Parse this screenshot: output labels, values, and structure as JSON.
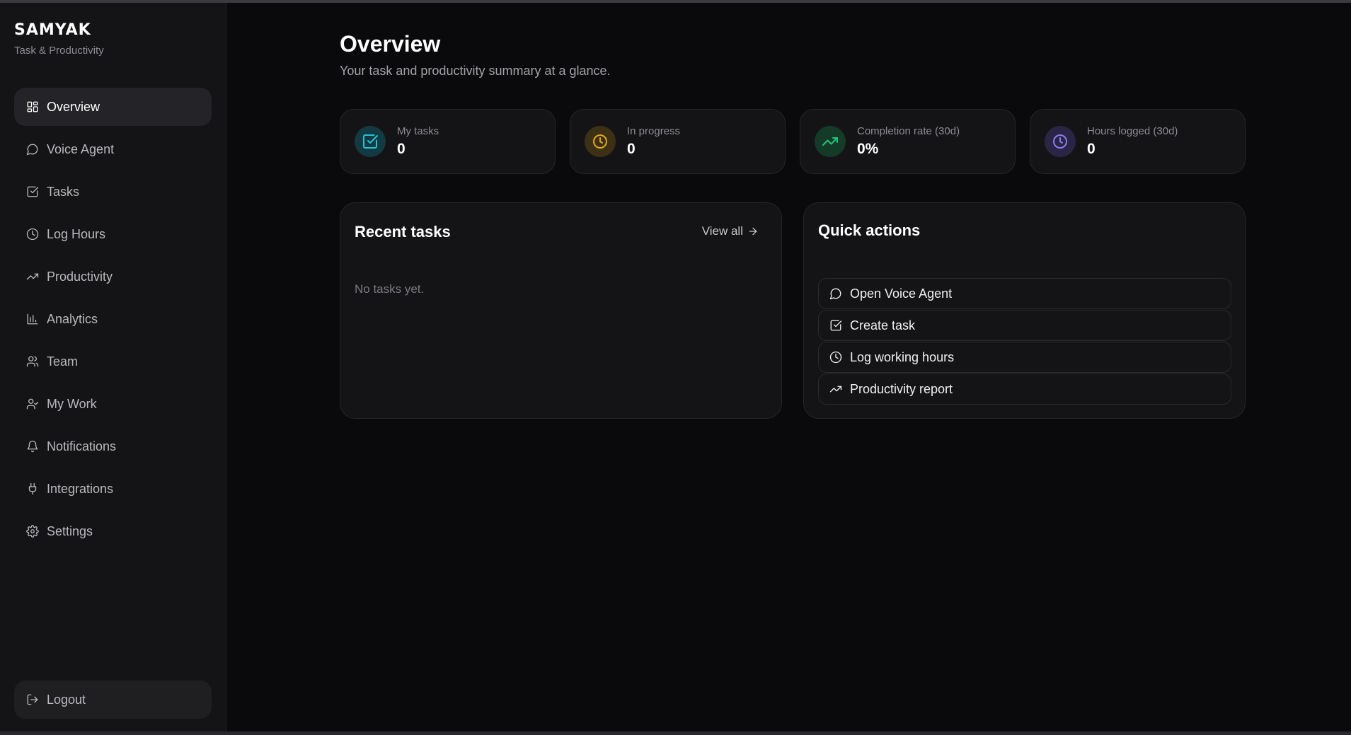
{
  "brand": {
    "name": "SAMYAK",
    "subtitle": "Task & Productivity"
  },
  "sidebar": {
    "items": [
      {
        "label": "Overview",
        "icon": "grid-icon",
        "active": true
      },
      {
        "label": "Voice Agent",
        "icon": "chat-bubble-icon"
      },
      {
        "label": "Tasks",
        "icon": "checkbox-icon"
      },
      {
        "label": "Log Hours",
        "icon": "clock-icon"
      },
      {
        "label": "Productivity",
        "icon": "trending-up-icon"
      },
      {
        "label": "Analytics",
        "icon": "bar-chart-icon"
      },
      {
        "label": "Team",
        "icon": "users-icon"
      },
      {
        "label": "My Work",
        "icon": "user-check-icon"
      },
      {
        "label": "Notifications",
        "icon": "bell-icon"
      },
      {
        "label": "Integrations",
        "icon": "plug-icon"
      },
      {
        "label": "Settings",
        "icon": "gear-icon"
      }
    ],
    "logout_label": "Logout"
  },
  "header": {
    "title": "Overview",
    "subtitle": "Your task and productivity summary at a glance."
  },
  "stats": [
    {
      "label": "My tasks",
      "value": "0",
      "icon": "checkbox-icon",
      "color": "#22c3d9"
    },
    {
      "label": "In progress",
      "value": "0",
      "icon": "clock-icon",
      "color": "#e0a526"
    },
    {
      "label": "Completion rate (30d)",
      "value": "0%",
      "icon": "trending-up-icon",
      "color": "#22c57e"
    },
    {
      "label": "Hours logged (30d)",
      "value": "0",
      "icon": "clock-icon",
      "color": "#8b7cf0"
    }
  ],
  "recent_tasks": {
    "title": "Recent tasks",
    "view_all_label": "View all",
    "empty_text": "No tasks yet."
  },
  "quick_actions": {
    "title": "Quick actions",
    "items": [
      {
        "label": "Open Voice Agent",
        "icon": "chat-bubble-icon"
      },
      {
        "label": "Create task",
        "icon": "checkbox-icon"
      },
      {
        "label": "Log working hours",
        "icon": "clock-icon"
      },
      {
        "label": "Productivity report",
        "icon": "trending-up-icon"
      }
    ]
  }
}
